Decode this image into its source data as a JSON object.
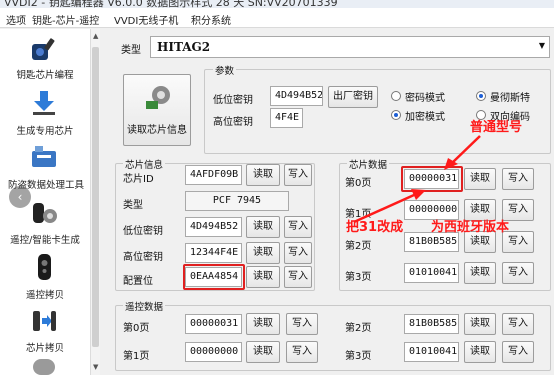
{
  "window": {
    "title": "VVDI2 - 钥匙编程器 V6.0.0      数据图示样式 28 天   SN:VV20701339"
  },
  "menu": [
    "选项",
    "钥匙-芯片-遥控",
    "VVDI无线子机",
    "积分系统"
  ],
  "sidebar": {
    "items": [
      {
        "label": "钥匙芯片编程",
        "icon": "key-chip-icon"
      },
      {
        "label": "生成专用芯片",
        "icon": "download-arrow-icon"
      },
      {
        "label": "防盗数据处理工具",
        "icon": "tools-icon"
      },
      {
        "label": "遥控/智能卡生成",
        "icon": "remote-gear-icon"
      },
      {
        "label": "遥控拷贝",
        "icon": "remote-copy-icon"
      },
      {
        "label": "芯片拷贝",
        "icon": "chip-copy-icon"
      }
    ]
  },
  "type": {
    "label": "类型",
    "value": "HITAG2"
  },
  "read_chip_info_button": "读取芯片信息",
  "params": {
    "title": "参数",
    "low_key_label": "低位密钥",
    "low_key_value": "4D494B52",
    "high_key_label": "高位密钥",
    "high_key_value": "4F4E",
    "factory_key_button": "出厂密钥",
    "radios": [
      {
        "label": "密码模式",
        "checked": false
      },
      {
        "label": "曼彻斯特",
        "checked": true
      },
      {
        "label": "加密模式",
        "checked": true
      },
      {
        "label": "双向编码",
        "checked": false
      }
    ]
  },
  "chip_info": {
    "title": "芯片信息",
    "read_label": "读取",
    "write_label": "写入",
    "rows": [
      {
        "label": "芯片ID",
        "value": "4AFDF09B"
      },
      {
        "label": "类型",
        "value": "PCF 7945"
      },
      {
        "label": "低位密钥",
        "value": "4D494B52"
      },
      {
        "label": "高位密钥",
        "value": "12344F4E"
      },
      {
        "label": "配置位",
        "value": "0EAA4854"
      }
    ]
  },
  "chip_data": {
    "title": "芯片数据",
    "read_label": "读取",
    "write_label": "写入",
    "pages": [
      {
        "label": "第0页",
        "value": "00000031"
      },
      {
        "label": "第1页",
        "value": "00000000"
      },
      {
        "label": "第2页",
        "value": "81B0B585"
      },
      {
        "label": "第3页",
        "value": "01010041"
      }
    ]
  },
  "remote_data": {
    "title": "遥控数据",
    "read_label": "读取",
    "write_label": "写入",
    "rows": [
      {
        "label": "第0页",
        "value": "00000031"
      },
      {
        "label": "第2页",
        "value": "81B0B585"
      },
      {
        "label": "第1页",
        "value": "00000000"
      },
      {
        "label": "第3页",
        "value": "01010041"
      }
    ]
  },
  "annotations": {
    "normal_model": "普通型号",
    "change_31": "把31改成",
    "change_31_tail": "为西班牙版本",
    "color": "#ff1a1a"
  }
}
